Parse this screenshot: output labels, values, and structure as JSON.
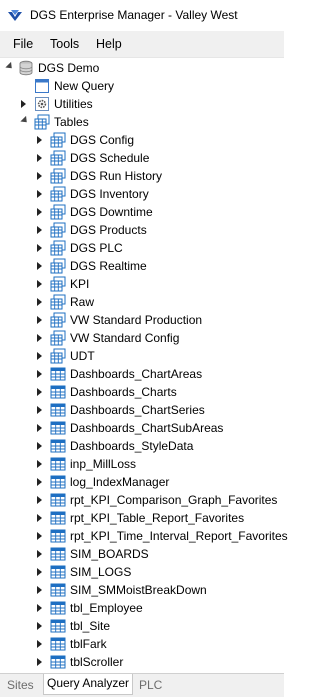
{
  "window": {
    "title": "DGS Enterprise Manager - Valley West"
  },
  "menu": {
    "items": [
      "File",
      "Tools",
      "Help"
    ]
  },
  "tree": {
    "root": "DGS Demo",
    "new_query": "New Query",
    "utilities": "Utilities",
    "tables": "Tables",
    "groups": [
      "DGS Config",
      "DGS Schedule",
      "DGS Run History",
      "DGS Inventory",
      "DGS Downtime",
      "DGS Products",
      "DGS PLC",
      "DGS Realtime",
      "KPI",
      "Raw",
      "VW Standard Production",
      "VW Standard Config",
      "UDT"
    ],
    "items": [
      "Dashboards_ChartAreas",
      "Dashboards_Charts",
      "Dashboards_ChartSeries",
      "Dashboards_ChartSubAreas",
      "Dashboards_StyleData",
      "inp_MillLoss",
      "log_IndexManager",
      "rpt_KPI_Comparison_Graph_Favorites",
      "rpt_KPI_Table_Report_Favorites",
      "rpt_KPI_Time_Interval_Report_Favorites",
      "SIM_BOARDS",
      "SIM_LOGS",
      "SIM_SMMoistBreakDown",
      "tbl_Employee",
      "tbl_Site",
      "tblFark",
      "tblScroller"
    ]
  },
  "tabs": [
    "Sites",
    "Query Analyzer",
    "PLC"
  ],
  "active_tab": "Query Analyzer",
  "colors": {
    "menubar": "#f0f0f0",
    "tab_bar": "#f0f0f0",
    "icon_blue": "#1e6fc2"
  }
}
